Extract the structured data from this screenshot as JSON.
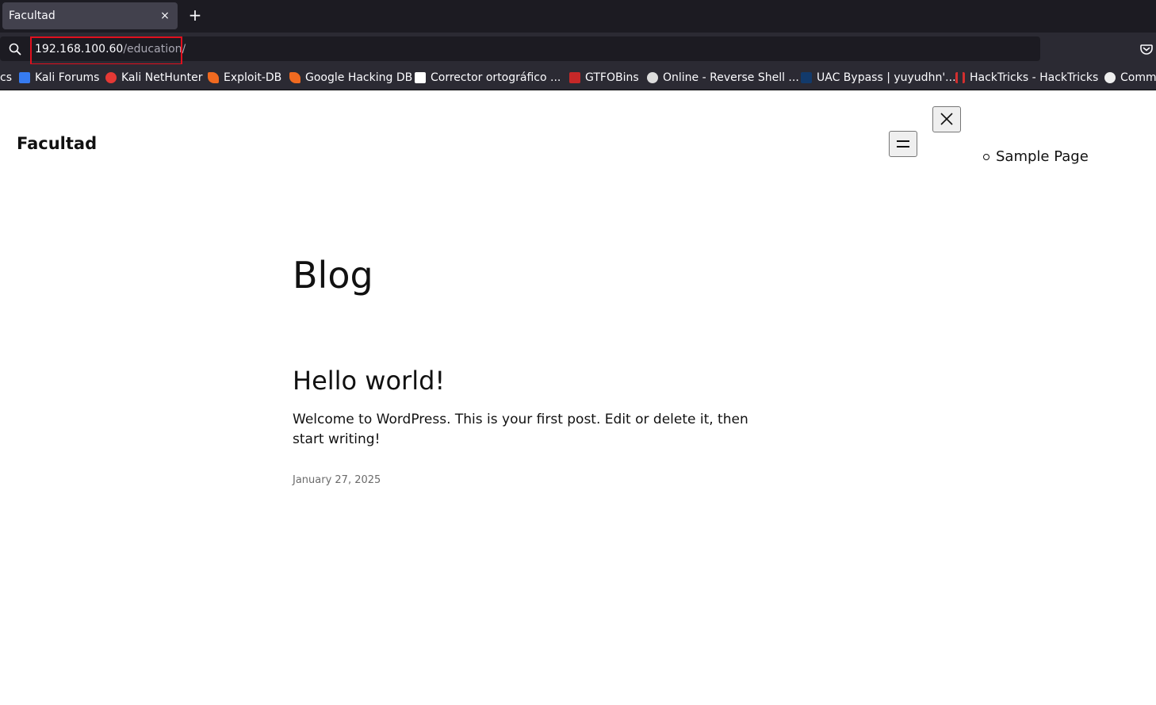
{
  "browser": {
    "tab_title": "Facultad",
    "tab_close_glyph": "×",
    "new_tab_glyph": "+",
    "url_host": "192.168.100.60",
    "url_path": "/education/",
    "highlight_color": "#e0101e"
  },
  "bookmarks": [
    {
      "label": "cs",
      "icon": "none",
      "color": ""
    },
    {
      "label": "Kali Forums",
      "icon": "kali-dragon-icon",
      "color": "#367bf0"
    },
    {
      "label": "Kali NetHunter",
      "icon": "nethunter-icon",
      "color": "#e53935"
    },
    {
      "label": "Exploit-DB",
      "icon": "exploit-db-icon",
      "color": "#f06a20"
    },
    {
      "label": "Google Hacking DB",
      "icon": "ghdb-icon",
      "color": "#f06a20"
    },
    {
      "label": "Corrector ortográfico ...",
      "icon": "corrector-icon",
      "color": "#ffffff"
    },
    {
      "label": "GTFOBins",
      "icon": "gtfobins-icon",
      "color": "#c62828"
    },
    {
      "label": "Online - Reverse Shell ...",
      "icon": "skull-icon",
      "color": "#dddddd"
    },
    {
      "label": "UAC Bypass | yuyudhn'...",
      "icon": "uac-icon",
      "color": "#123a6b"
    },
    {
      "label": "HackTricks - HackTricks",
      "icon": "hacktricks-icon",
      "color": "#d32f2f"
    },
    {
      "label": "Comma",
      "icon": "penguin-icon",
      "color": "#eeeeee"
    }
  ],
  "site": {
    "title": "Facultad",
    "menu_items": [
      {
        "label": "Sample Page"
      }
    ],
    "close_glyph": "✕"
  },
  "main": {
    "heading": "Blog",
    "post": {
      "title": "Hello world!",
      "excerpt": "Welcome to WordPress. This is your first post. Edit or delete it, then start writing!",
      "date": "January 27, 2025"
    }
  }
}
